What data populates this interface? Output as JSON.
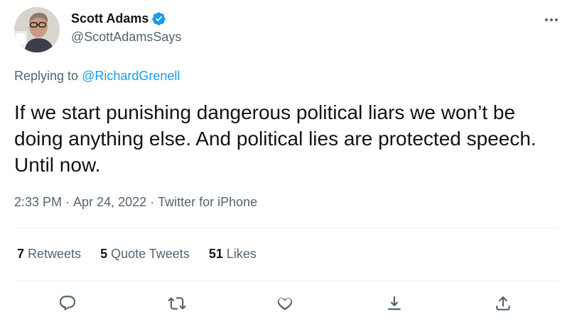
{
  "author": {
    "display_name": "Scott Adams",
    "handle": "@ScottAdamsSays",
    "verified": true,
    "avatar_icon": "profile-photo"
  },
  "reply": {
    "prefix": "Replying to ",
    "to": "@RichardGrenell"
  },
  "tweet": {
    "text": "If we start punishing dangerous political liars we won’t be doing anything else. And political lies are protected speech. Until now."
  },
  "meta": {
    "time": "2:33 PM",
    "sep1": " · ",
    "date": "Apr 24, 2022",
    "sep2": " · ",
    "source": "Twitter for iPhone"
  },
  "stats": {
    "retweets_count": "7",
    "retweets_label": " Retweets",
    "quotes_count": "5",
    "quotes_label": " Quote Tweets",
    "likes_count": "51",
    "likes_label": " Likes"
  },
  "actions": [
    "reply-icon",
    "retweet-icon",
    "like-icon",
    "bookmark-icon",
    "share-icon"
  ],
  "colors": {
    "accent": "#1d9bf0",
    "secondary_text": "#536471",
    "primary_text": "#0f1419"
  }
}
